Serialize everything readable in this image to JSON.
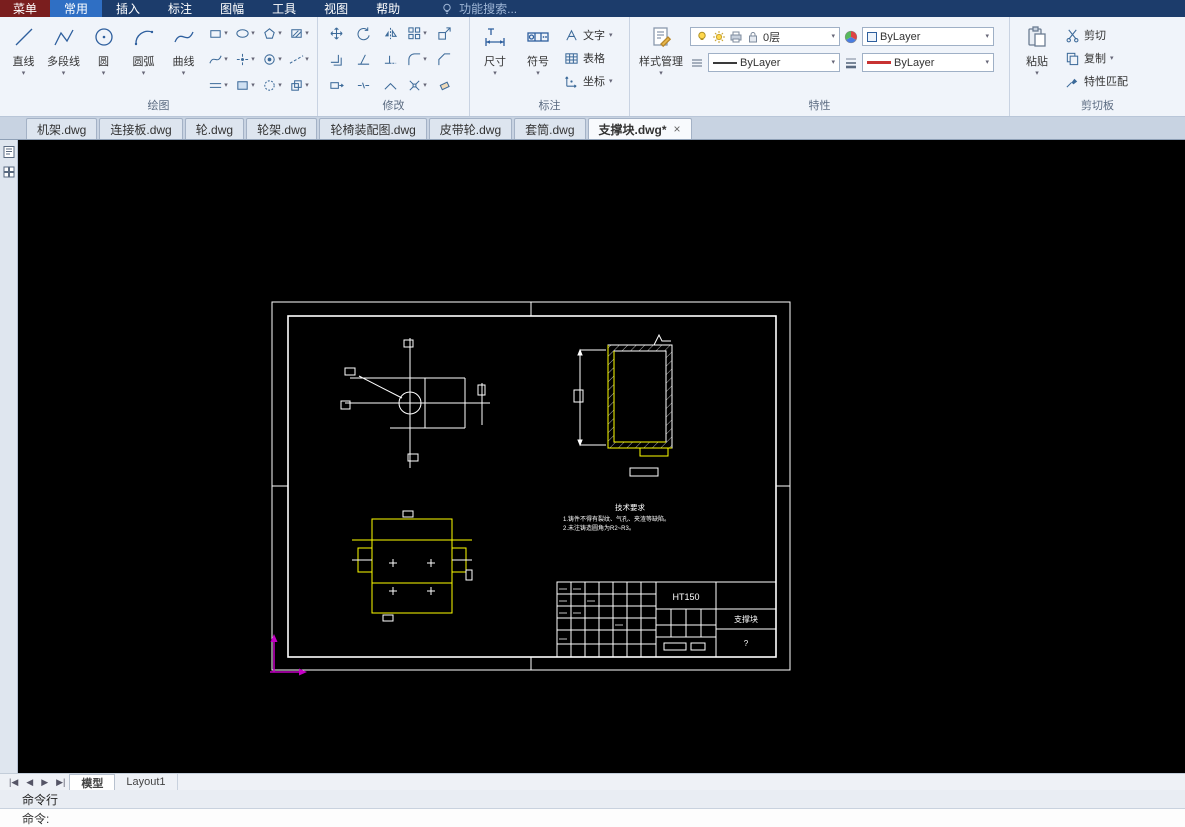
{
  "colors": {
    "white": "#ffffff",
    "yellow": "#ffff00",
    "magenta": "#c400c4",
    "accent": "#2f6fc4"
  },
  "menubar": {
    "menu": "菜单",
    "tabs": [
      "常用",
      "插入",
      "标注",
      "图幅",
      "工具",
      "视图",
      "帮助"
    ],
    "search": "功能搜索..."
  },
  "ribbon": {
    "draw": {
      "label": "绘图",
      "line": "直线",
      "polyline": "多段线",
      "circle": "圆",
      "arc": "圆弧",
      "curve": "曲线"
    },
    "modify": {
      "label": "修改"
    },
    "annotate": {
      "label": "标注",
      "dimension": "尺寸",
      "symbol": "符号",
      "text": "文字",
      "table": "表格",
      "coord": "坐标"
    },
    "props": {
      "label": "特性",
      "style": "样式管理",
      "layer": "0层",
      "color": "ByLayer",
      "linetype": "ByLayer",
      "lineweight": "ByLayer"
    },
    "clip": {
      "label": "剪切板",
      "paste": "粘贴",
      "cut": "剪切",
      "copy": "复制",
      "match": "特性匹配"
    }
  },
  "doc_tabs": [
    {
      "label": "机架.dwg"
    },
    {
      "label": "连接板.dwg"
    },
    {
      "label": "轮.dwg"
    },
    {
      "label": "轮架.dwg"
    },
    {
      "label": "轮椅装配图.dwg"
    },
    {
      "label": "皮带轮.dwg"
    },
    {
      "label": "套筒.dwg"
    },
    {
      "label": "支撑块.dwg*"
    }
  ],
  "drawing": {
    "material": "HT150",
    "part": "支撑块",
    "qty": "?",
    "notes_title": "技术要求",
    "note1": "1.铸件不得有裂纹、气孔、夹渣等缺陷。",
    "note2": "2.未注铸造圆角为R2~R3。"
  },
  "statusbar": {
    "model": "模型",
    "layout": "Layout1"
  },
  "command": {
    "title": "命令行",
    "prompt": "命令:"
  },
  "glyphs": {
    "dropdown": "▾",
    "close": "×",
    "nav_first": "|◀",
    "nav_prev": "◀",
    "nav_next": "▶",
    "nav_last": "▶|"
  }
}
